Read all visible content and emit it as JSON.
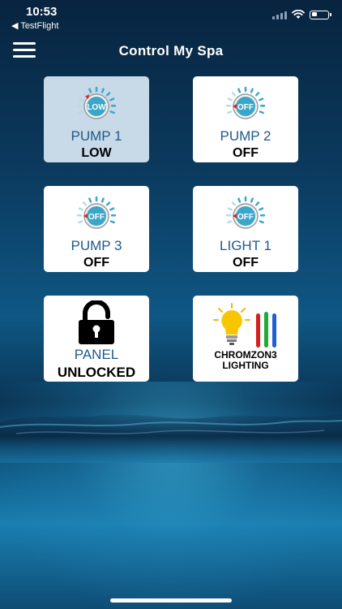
{
  "status_bar": {
    "time": "10:53",
    "back_app": "◀ TestFlight",
    "battery_level": 0.35
  },
  "header": {
    "title": "Control My Spa",
    "menu_icon": "hamburger-menu-icon"
  },
  "tiles": [
    {
      "name": "PUMP 1",
      "state": "LOW",
      "dial_label": "LOW",
      "active": true
    },
    {
      "name": "PUMP 2",
      "state": "OFF",
      "dial_label": "OFF",
      "active": false
    },
    {
      "name": "PUMP 3",
      "state": "OFF",
      "dial_label": "OFF",
      "active": false
    },
    {
      "name": "LIGHT 1",
      "state": "OFF",
      "dial_label": "OFF",
      "active": false
    },
    {
      "name": "PANEL",
      "state": "UNLOCKED",
      "icon": "padlock-icon"
    },
    {
      "brand_line1": "CHROMZON3",
      "brand_line2": "LIGHTING",
      "icon": "lightbulb-icon"
    }
  ],
  "colors": {
    "tile_label": "#1e5a8c",
    "active_tile": "#c8d9e8",
    "dial_ring": "#3aa7c9",
    "indicator": "#d62828"
  }
}
